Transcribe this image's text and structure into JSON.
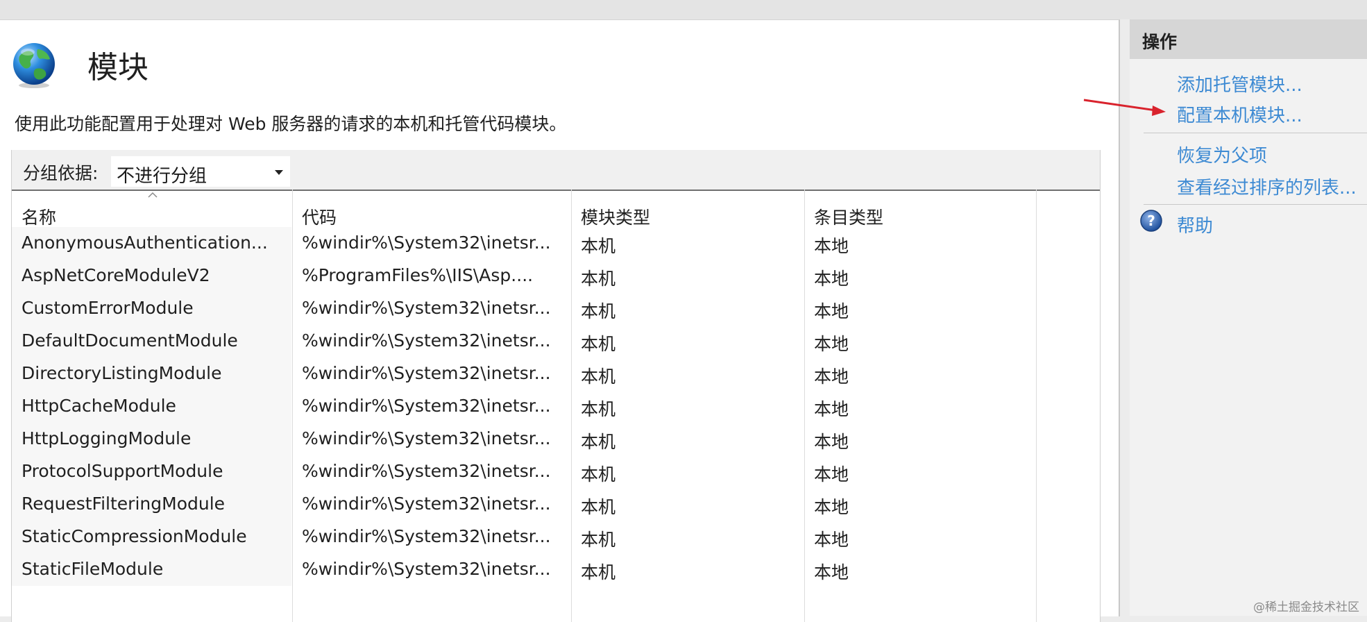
{
  "page": {
    "title": "模块",
    "description": "使用此功能配置用于处理对 Web 服务器的请求的本机和托管代码模块。"
  },
  "grouping": {
    "label": "分组依据:",
    "value": "不进行分组"
  },
  "columns": [
    "名称",
    "代码",
    "模块类型",
    "条目类型"
  ],
  "rows": [
    {
      "name": "AnonymousAuthentication...",
      "code": "%windir%\\System32\\inetsr...",
      "module_type": "本机",
      "entry_type": "本地"
    },
    {
      "name": "AspNetCoreModuleV2",
      "code": "%ProgramFiles%\\IIS\\Asp....",
      "module_type": "本机",
      "entry_type": "本地"
    },
    {
      "name": "CustomErrorModule",
      "code": "%windir%\\System32\\inetsr...",
      "module_type": "本机",
      "entry_type": "本地"
    },
    {
      "name": "DefaultDocumentModule",
      "code": "%windir%\\System32\\inetsr...",
      "module_type": "本机",
      "entry_type": "本地"
    },
    {
      "name": "DirectoryListingModule",
      "code": "%windir%\\System32\\inetsr...",
      "module_type": "本机",
      "entry_type": "本地"
    },
    {
      "name": "HttpCacheModule",
      "code": "%windir%\\System32\\inetsr...",
      "module_type": "本机",
      "entry_type": "本地"
    },
    {
      "name": "HttpLoggingModule",
      "code": "%windir%\\System32\\inetsr...",
      "module_type": "本机",
      "entry_type": "本地"
    },
    {
      "name": "ProtocolSupportModule",
      "code": "%windir%\\System32\\inetsr...",
      "module_type": "本机",
      "entry_type": "本地"
    },
    {
      "name": "RequestFilteringModule",
      "code": "%windir%\\System32\\inetsr...",
      "module_type": "本机",
      "entry_type": "本地"
    },
    {
      "name": "StaticCompressionModule",
      "code": "%windir%\\System32\\inetsr...",
      "module_type": "本机",
      "entry_type": "本地"
    },
    {
      "name": "StaticFileModule",
      "code": "%windir%\\System32\\inetsr...",
      "module_type": "本机",
      "entry_type": "本地"
    }
  ],
  "actions": {
    "title": "操作",
    "add_managed": "添加托管模块...",
    "configure_native": "配置本机模块...",
    "revert_parent": "恢复为父项",
    "view_ordered": "查看经过排序的列表...",
    "help": "帮助"
  },
  "watermark": "@稀土掘金技术社区",
  "colors": {
    "link": "#3d8ad3",
    "annotation_arrow": "#d9232d"
  },
  "icons": {
    "page": "globe-icon",
    "help": "help-icon",
    "group_dropdown": "chevron-down-icon",
    "sort": "sort-ascending-icon"
  }
}
